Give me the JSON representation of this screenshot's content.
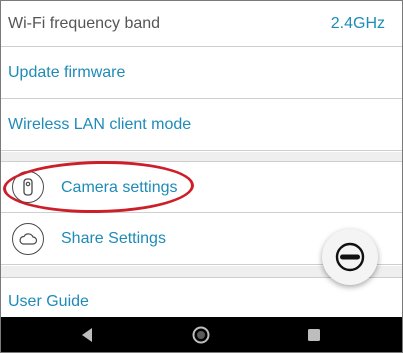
{
  "settings": {
    "wifi_band": {
      "label": "Wi-Fi frequency band",
      "value": "2.4GHz"
    },
    "update_firmware": {
      "label": "Update firmware"
    },
    "wireless_lan": {
      "label": "Wireless LAN client mode"
    },
    "camera_settings": {
      "label": "Camera settings",
      "icon": "camera-icon"
    },
    "share_settings": {
      "label": "Share Settings",
      "icon": "cloud-icon"
    },
    "user_guide": {
      "label": "User Guide"
    }
  },
  "fab": {
    "icon": "shutter-icon"
  },
  "annotation": {
    "color": "#cc1f2a"
  },
  "navbar": {
    "icons": [
      "back-icon",
      "home-icon",
      "recents-icon"
    ]
  },
  "colors": {
    "accent": "#1e8bb8",
    "label_grey": "#555555",
    "divider": "#cfcfcf",
    "section_gap": "#efefef",
    "navbar": "#000000"
  }
}
